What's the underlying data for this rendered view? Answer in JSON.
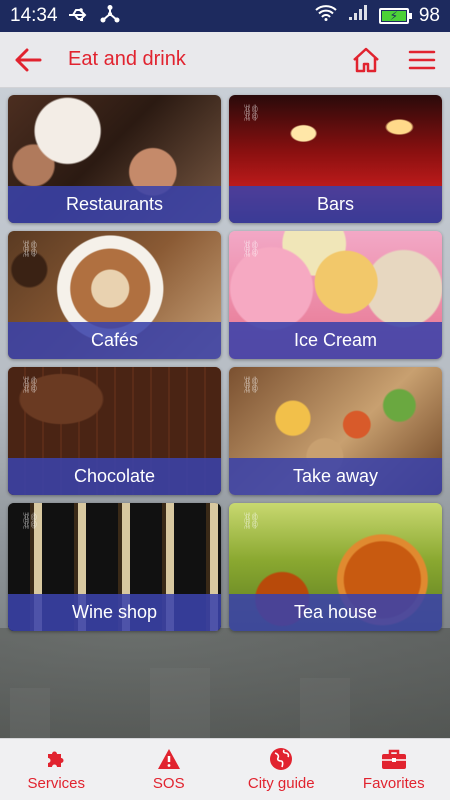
{
  "status_bar": {
    "time": "14:34",
    "battery_level": "98",
    "icons": [
      "usb-icon",
      "share-icon",
      "wifi-icon",
      "signal-icon",
      "battery-charging-icon"
    ]
  },
  "appbar": {
    "title": "Eat and drink",
    "back_icon": "arrow-left-icon",
    "home_icon": "home-icon",
    "menu_icon": "hamburger-menu-icon",
    "accent_color": "#e1232f"
  },
  "categories": [
    {
      "label": "Restaurants"
    },
    {
      "label": "Bars"
    },
    {
      "label": "Cafés"
    },
    {
      "label": "Ice Cream"
    },
    {
      "label": "Chocolate"
    },
    {
      "label": "Take away"
    },
    {
      "label": "Wine shop"
    },
    {
      "label": "Tea house"
    }
  ],
  "bottom_nav": {
    "items": [
      {
        "label": "Services",
        "icon": "puzzle-icon"
      },
      {
        "label": "SOS",
        "icon": "warning-icon"
      },
      {
        "label": "City guide",
        "icon": "globe-icon"
      },
      {
        "label": "Favorites",
        "icon": "briefcase-icon"
      }
    ]
  },
  "colors": {
    "status_bar": "#1d2a5e",
    "tile_label_bg": "#3a42aa",
    "accent": "#e1232f"
  }
}
